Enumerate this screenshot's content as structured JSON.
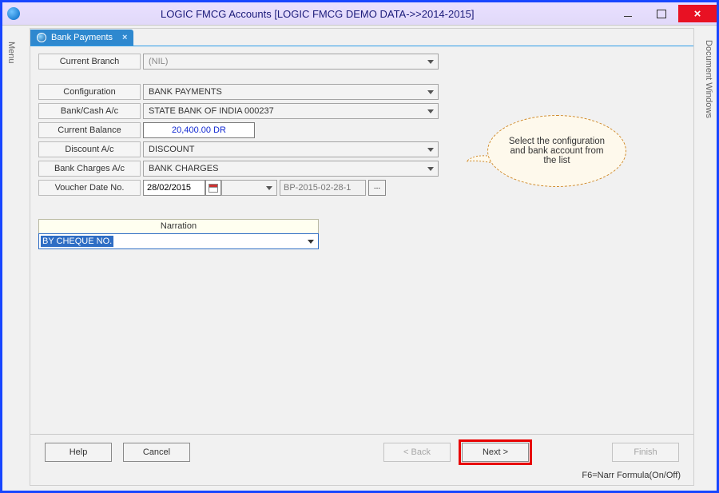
{
  "window": {
    "title": "LOGIC FMCG Accounts  [LOGIC FMCG DEMO DATA->>2014-2015]"
  },
  "side": {
    "left": "Menu",
    "right": "Document Windows"
  },
  "tab": {
    "label": "Bank Payments",
    "close": "×"
  },
  "labels": {
    "current_branch": "Current Branch",
    "configuration": "Configuration",
    "bank_cash_ac": "Bank/Cash A/c",
    "current_balance": "Current Balance",
    "discount_ac": "Discount A/c",
    "bank_charges_ac": "Bank Charges A/c",
    "voucher_date_no": "Voucher Date  No."
  },
  "values": {
    "current_branch": "(NIL)",
    "configuration": "BANK PAYMENTS",
    "bank_cash_ac": "STATE BANK OF INDIA 000237",
    "current_balance": "20,400.00 DR",
    "discount_ac": "DISCOUNT",
    "bank_charges_ac": "BANK CHARGES",
    "voucher_date": "28/02/2015",
    "voucher_no": "BP-2015-02-28-1"
  },
  "narration": {
    "header": "Narration",
    "selected": "BY CHEQUE NO."
  },
  "callout": {
    "text": "Select the configuration and bank account from the list"
  },
  "buttons": {
    "help": "Help",
    "cancel": "Cancel",
    "back": "< Back",
    "next": "Next >",
    "finish": "Finish",
    "dots": "..."
  },
  "status": {
    "hint": "F6=Narr Formula(On/Off)"
  }
}
